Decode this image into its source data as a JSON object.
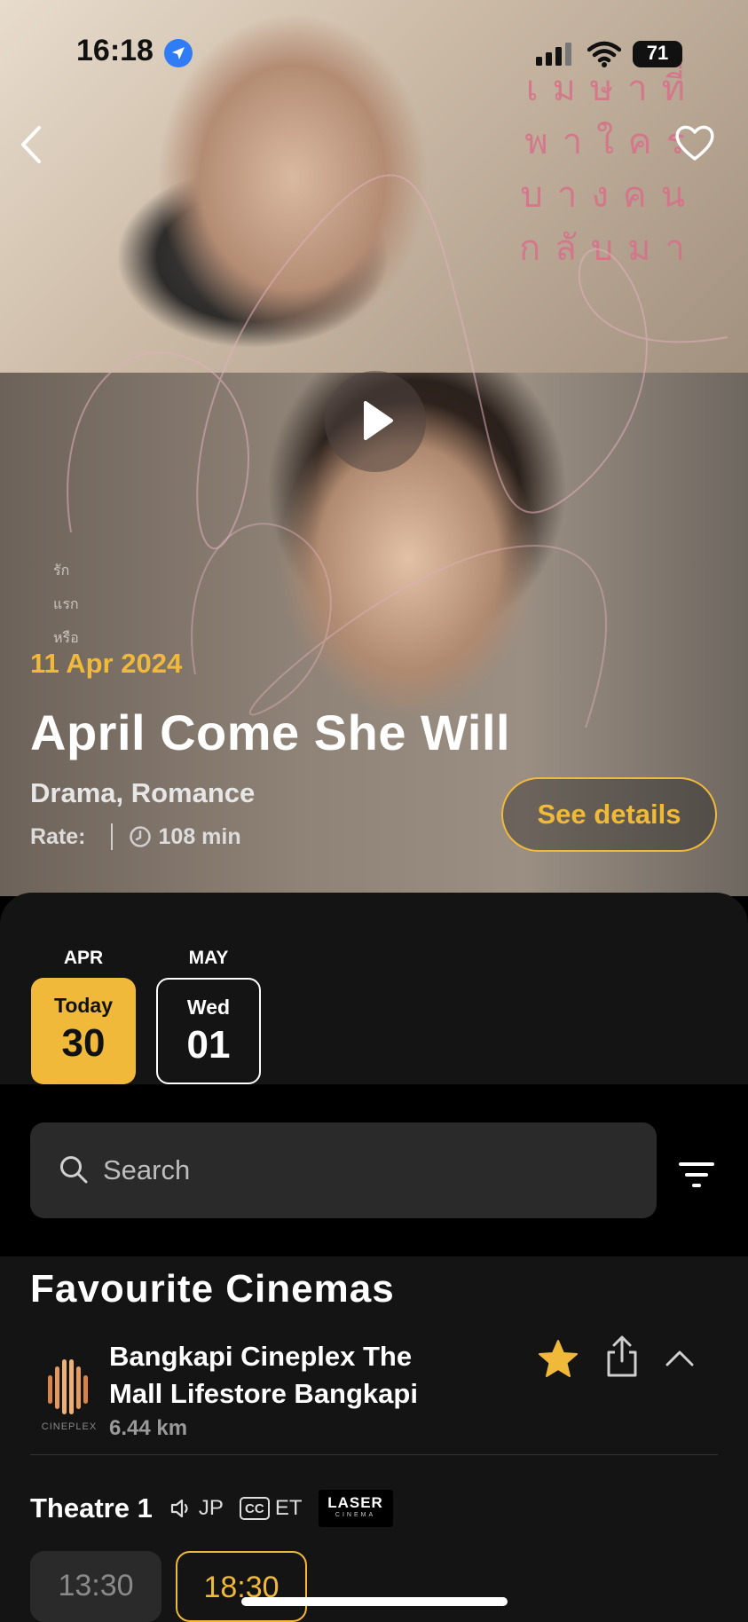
{
  "status_bar": {
    "time": "16:18",
    "battery": "71"
  },
  "hero": {
    "poster_thai_text": "เมษาที่พาใครบางคนกลับมา",
    "poster_side_text": [
      "รัก",
      "แรก",
      "หรือ"
    ],
    "release_date": "11 Apr 2024",
    "title": "April Come She Will",
    "genres": "Drama, Romance",
    "rate_label": "Rate:",
    "duration": "108 min",
    "see_details_label": "See details"
  },
  "dates": {
    "items": [
      {
        "month": "APR",
        "day_label": "Today",
        "day_number": "30",
        "selected": true
      },
      {
        "month": "MAY",
        "day_label": "Wed",
        "day_number": "01",
        "selected": false
      }
    ]
  },
  "search": {
    "placeholder": "Search",
    "value": ""
  },
  "cinemas": {
    "heading": "Favourite Cinemas",
    "items": [
      {
        "logo_text": "CINEPLEX",
        "name": "Bangkapi Cineplex The Mall Lifestore Bangkapi",
        "distance": "6.44 km",
        "favourite": true,
        "theatre": {
          "name": "Theatre 1",
          "audio": "JP",
          "subtitle": "ET",
          "cc_label": "CC",
          "format_line1": "LASER",
          "format_line2": "CINEMA"
        },
        "showtimes": [
          {
            "time": "13:30",
            "state": "past"
          },
          {
            "time": "18:30",
            "state": "available"
          }
        ]
      }
    ]
  },
  "colors": {
    "accent": "#f0b93a",
    "panel": "#141414",
    "search_bg": "#2a2a2a",
    "poster_pink": "#d8708a"
  }
}
